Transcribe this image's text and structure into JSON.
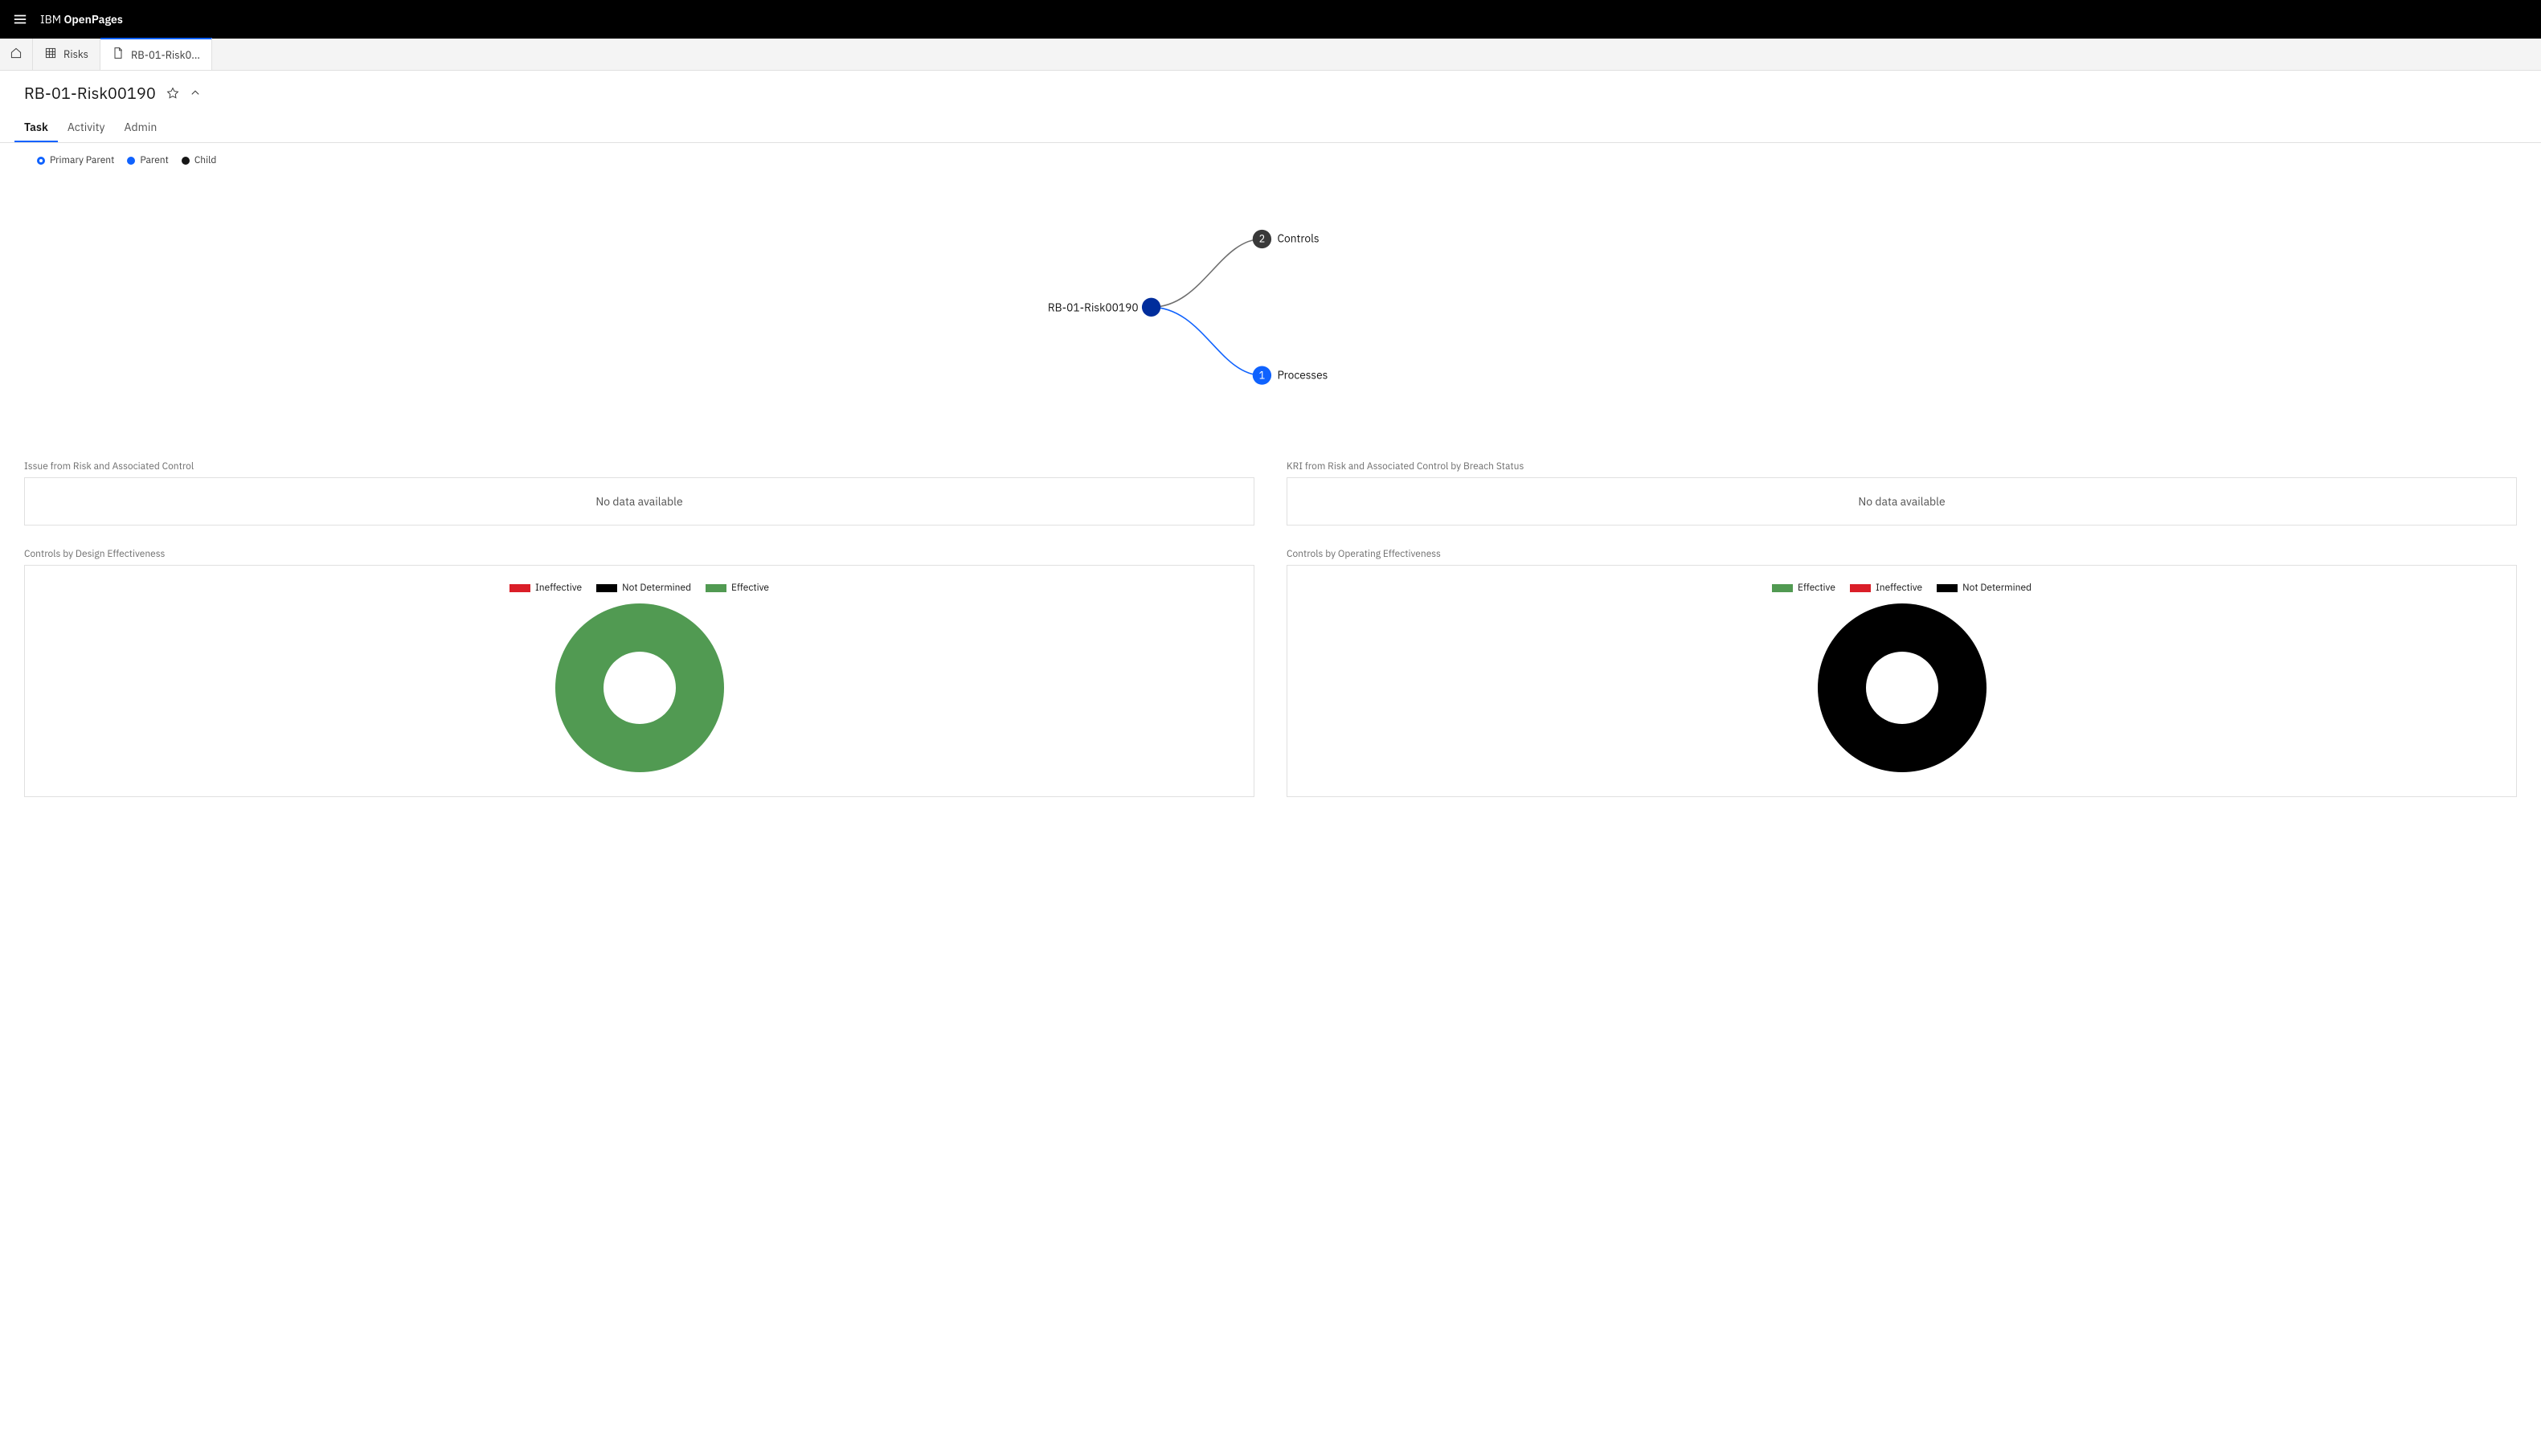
{
  "header": {
    "brand_prefix": "IBM",
    "brand_name": "OpenPages"
  },
  "nav_tabs": {
    "risks": "Risks",
    "current": "RB-01-Risk0..."
  },
  "page_title": "RB-01-Risk00190",
  "sub_tabs": {
    "task": "Task",
    "activity": "Activity",
    "admin": "Admin"
  },
  "graph": {
    "legend": {
      "primary_parent": "Primary Parent",
      "parent": "Parent",
      "child": "Child"
    },
    "root_label": "RB-01-Risk00190",
    "nodes": {
      "controls": {
        "count": "2",
        "label": "Controls",
        "type": "child"
      },
      "processes": {
        "count": "1",
        "label": "Processes",
        "type": "parent"
      }
    }
  },
  "panels": {
    "issue": {
      "title": "Issue from Risk and Associated Control",
      "empty": "No data available"
    },
    "kri": {
      "title": "KRI from Risk and Associated Control by Breach Status",
      "empty": "No data available"
    },
    "design": {
      "title": "Controls by Design Effectiveness",
      "legend": {
        "ineffective": "Ineffective",
        "not_determined": "Not Determined",
        "effective": "Effective"
      }
    },
    "operating": {
      "title": "Controls by Operating Effectiveness",
      "legend": {
        "effective": "Effective",
        "ineffective": "Ineffective",
        "not_determined": "Not Determined"
      }
    }
  },
  "chart_data": [
    {
      "type": "pie",
      "title": "Controls by Design Effectiveness",
      "series": [
        {
          "name": "Ineffective",
          "value": 0,
          "color": "#da1e28"
        },
        {
          "name": "Not Determined",
          "value": 0,
          "color": "#000000"
        },
        {
          "name": "Effective",
          "value": 2,
          "color": "#519a52"
        }
      ]
    },
    {
      "type": "pie",
      "title": "Controls by Operating Effectiveness",
      "series": [
        {
          "name": "Effective",
          "value": 0,
          "color": "#519a52"
        },
        {
          "name": "Ineffective",
          "value": 0,
          "color": "#da1e28"
        },
        {
          "name": "Not Determined",
          "value": 2,
          "color": "#000000"
        }
      ]
    }
  ],
  "colors": {
    "accent": "#0f62fe",
    "green": "#519a52",
    "red": "#da1e28",
    "black": "#000000"
  }
}
